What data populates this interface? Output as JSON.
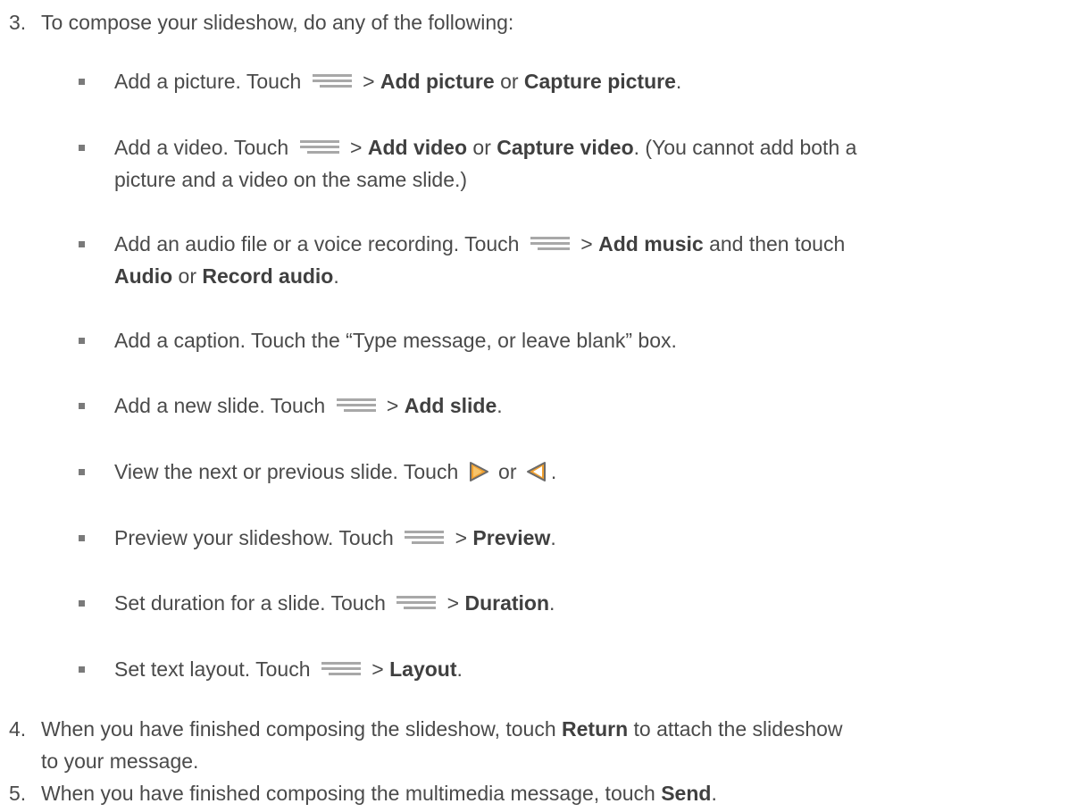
{
  "step3": {
    "number": "3.",
    "text": "To compose your slideshow, do any of the following:"
  },
  "bullets": {
    "b1": {
      "pre": "Add a picture. Touch",
      "sep": ">",
      "bold1": "Add picture",
      "mid": "or",
      "bold2": "Capture picture",
      "end": "."
    },
    "b2": {
      "pre": "Add a video. Touch",
      "sep": ">",
      "bold1": "Add video",
      "mid": "or",
      "bold2": "Capture video",
      "end": ". (You cannot add both a",
      "line2": "picture and a video on the same slide.)"
    },
    "b3": {
      "pre": "Add an audio file or a voice recording. Touch",
      "sep": ">",
      "bold1": "Add music",
      "mid": "and then touch",
      "bold2": "Audio",
      "mid2": "or",
      "bold3": "Record audio",
      "end": "."
    },
    "b4": {
      "text": "Add a caption. Touch the “Type message, or leave blank” box."
    },
    "b5": {
      "pre": "Add a new slide. Touch",
      "sep": ">",
      "bold1": "Add slide",
      "end": "."
    },
    "b6": {
      "pre": "View the next or previous slide. Touch",
      "mid": "or",
      "end": "."
    },
    "b7": {
      "pre": "Preview your slideshow. Touch",
      "sep": ">",
      "bold1": "Preview",
      "end": "."
    },
    "b8": {
      "pre": "Set duration for a slide. Touch",
      "sep": ">",
      "bold1": "Duration",
      "end": "."
    },
    "b9": {
      "pre": "Set text layout. Touch",
      "sep": ">",
      "bold1": "Layout",
      "end": "."
    }
  },
  "step4": {
    "number": "4.",
    "pre": "When you have finished composing the slideshow, touch",
    "bold": "Return",
    "post": "to attach the slideshow",
    "line2": "to your message."
  },
  "step5": {
    "number": "5.",
    "pre": "When you have finished composing the multimedia message, touch",
    "bold": "Send",
    "end": "."
  },
  "icons": {
    "menu": "menu-lines-icon",
    "next": "next-slide-arrow-icon",
    "prev": "previous-slide-arrow-icon"
  },
  "colors": {
    "text": "#4a4a4a",
    "bullet": "#7a7a7a",
    "icon_lines": "#a8a8a8",
    "arrow_fill": "#f0a030",
    "arrow_border": "#6a6a6a"
  }
}
